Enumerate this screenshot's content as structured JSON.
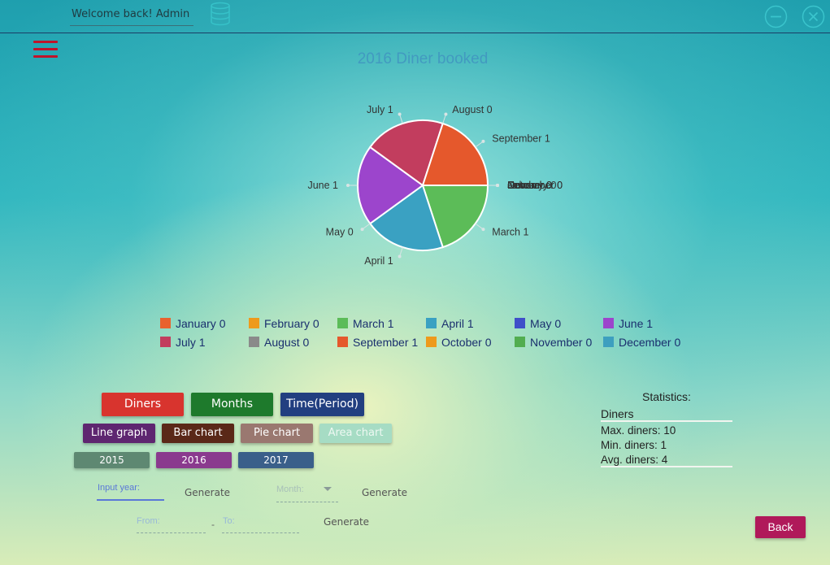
{
  "header": {
    "welcome_text": "Welcome back! Admin",
    "database_icon": "database-icon",
    "minimize_icon": "minimize-icon",
    "close_icon": "close-icon"
  },
  "menu_icon": "hamburger-menu-icon",
  "chart_data": {
    "type": "pie",
    "title": "2016 Diner booked",
    "categories": [
      "January",
      "February",
      "March",
      "April",
      "May",
      "June",
      "July",
      "August",
      "September",
      "October",
      "November",
      "December"
    ],
    "values": [
      0,
      0,
      1,
      1,
      0,
      1,
      1,
      0,
      1,
      0,
      0,
      0
    ],
    "colors": [
      "#e8622e",
      "#ee9a1c",
      "#5cbc58",
      "#3aa1c2",
      "#3f4fc9",
      "#9c45cc",
      "#c23d5e",
      "#8a8a8a",
      "#e5582c",
      "#ee9a1c",
      "#52ad50",
      "#3d9fbf"
    ],
    "slice_labels": [
      "January 0",
      "February 0",
      "March 1",
      "April 1",
      "May 0",
      "June 1",
      "July 1",
      "August 0",
      "September 1",
      "October 0",
      "November 0",
      "December 0"
    ],
    "legend": [
      "January 0",
      "February 0",
      "March 1",
      "April 1",
      "May 0",
      "June 1",
      "July 1",
      "August 0",
      "September 1",
      "October 0",
      "November 0",
      "December 0"
    ],
    "legend_placement": "bottom"
  },
  "buttons": {
    "diners": "Diners",
    "months": "Months",
    "time_period": "Time(Period)",
    "line_graph": "Line graph",
    "bar_chart": "Bar chart",
    "pie_chart": "Pie chart",
    "area_chart": "Area chart",
    "year_2015": "2015",
    "year_2016": "2016",
    "year_2017": "2017",
    "back": "Back"
  },
  "colors": {
    "diners": "#d8342e",
    "months": "#1e7a2c",
    "time_period": "#223f80",
    "line_graph": "#5e2670",
    "bar_chart": "#5a2818",
    "pie_chart": "#9a7870",
    "area_chart": "#a6dcc4",
    "year_2015": "#5e8872",
    "year_2016": "#8a3a8e",
    "year_2017": "#3a5f8a"
  },
  "form": {
    "year_placeholder": "Input year:",
    "year_generate": "Generate",
    "month_placeholder": "Month:",
    "month_generate": "Generate",
    "from_placeholder": "From:",
    "range_separator": "-",
    "to_placeholder": "To:",
    "range_generate": "Generate"
  },
  "stats": {
    "title": "Statistics:",
    "subtitle": "Diners",
    "max": "Max. diners: 10",
    "min": "Min. diners: 1",
    "avg": "Avg. diners: 4"
  }
}
